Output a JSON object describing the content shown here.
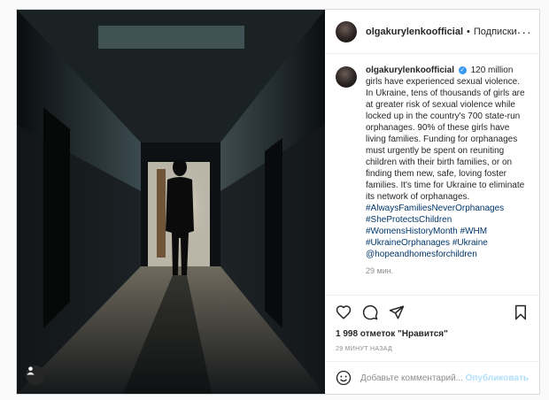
{
  "header": {
    "username": "olgakurylenkoofficial",
    "separator": "•",
    "follow_label": "Подписки",
    "more_label": "···"
  },
  "caption": {
    "username": "olgakurylenkoofficial",
    "verified_label": "✓",
    "text": "120 million girls have experienced sexual violence. In Ukraine, tens of thousands of girls are at greater risk of sexual violence while locked up in the country's 700 state-run orphanages. 90% of these girls have living families. Funding for orphanages must urgently be spent on reuniting children with their birth families, or on finding them new, safe, loving foster families. It's time for Ukraine to eliminate its network of orphanages.",
    "hashtags": [
      "#AlwaysFamiliesNeverOrphanages",
      "#SheProtectsChildren",
      "#WomensHistoryMonth #WHM",
      "#UkraineOrphanages #Ukraine",
      "@hopeandhomesforchildren"
    ],
    "time_ago": "29 мин."
  },
  "actions": {
    "likes": "1 998 отметок \"Нравится\"",
    "posted": "29 минут назад"
  },
  "comment": {
    "placeholder": "Добавьте комментарий...",
    "publish_label": "Опубликовать"
  },
  "icons": [
    "heart-icon",
    "comment-icon",
    "share-icon",
    "bookmark-icon",
    "emoji-icon",
    "user-tag-icon"
  ],
  "colors": {
    "link": "#00376b",
    "verified": "#3897f0",
    "publish": "#b2dffc",
    "muted": "#8e8e8e"
  }
}
